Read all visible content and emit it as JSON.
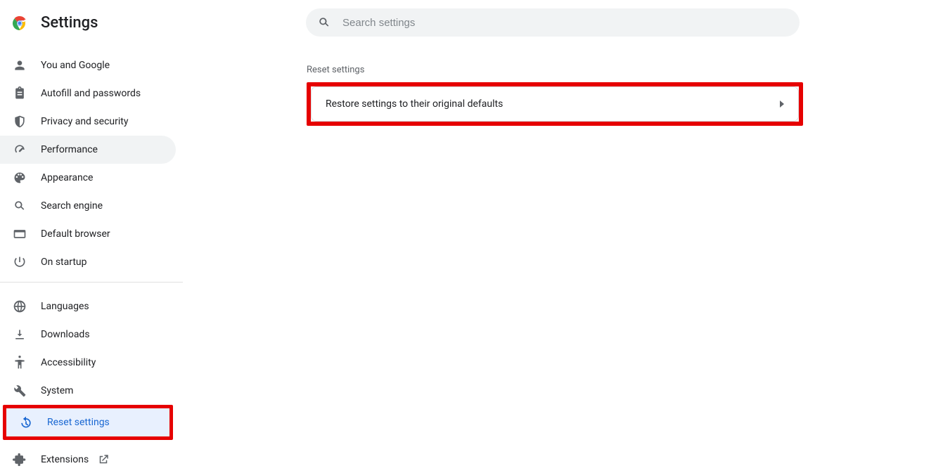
{
  "header": {
    "title": "Settings"
  },
  "search": {
    "placeholder": "Search settings"
  },
  "sidebar": {
    "group1": [
      {
        "label": "You and Google"
      },
      {
        "label": "Autofill and passwords"
      },
      {
        "label": "Privacy and security"
      },
      {
        "label": "Performance"
      },
      {
        "label": "Appearance"
      },
      {
        "label": "Search engine"
      },
      {
        "label": "Default browser"
      },
      {
        "label": "On startup"
      }
    ],
    "group2": [
      {
        "label": "Languages"
      },
      {
        "label": "Downloads"
      },
      {
        "label": "Accessibility"
      },
      {
        "label": "System"
      },
      {
        "label": "Reset settings"
      }
    ],
    "extensions_label": "Extensions"
  },
  "main": {
    "section_title": "Reset settings",
    "row_label": "Restore settings to their original defaults"
  }
}
